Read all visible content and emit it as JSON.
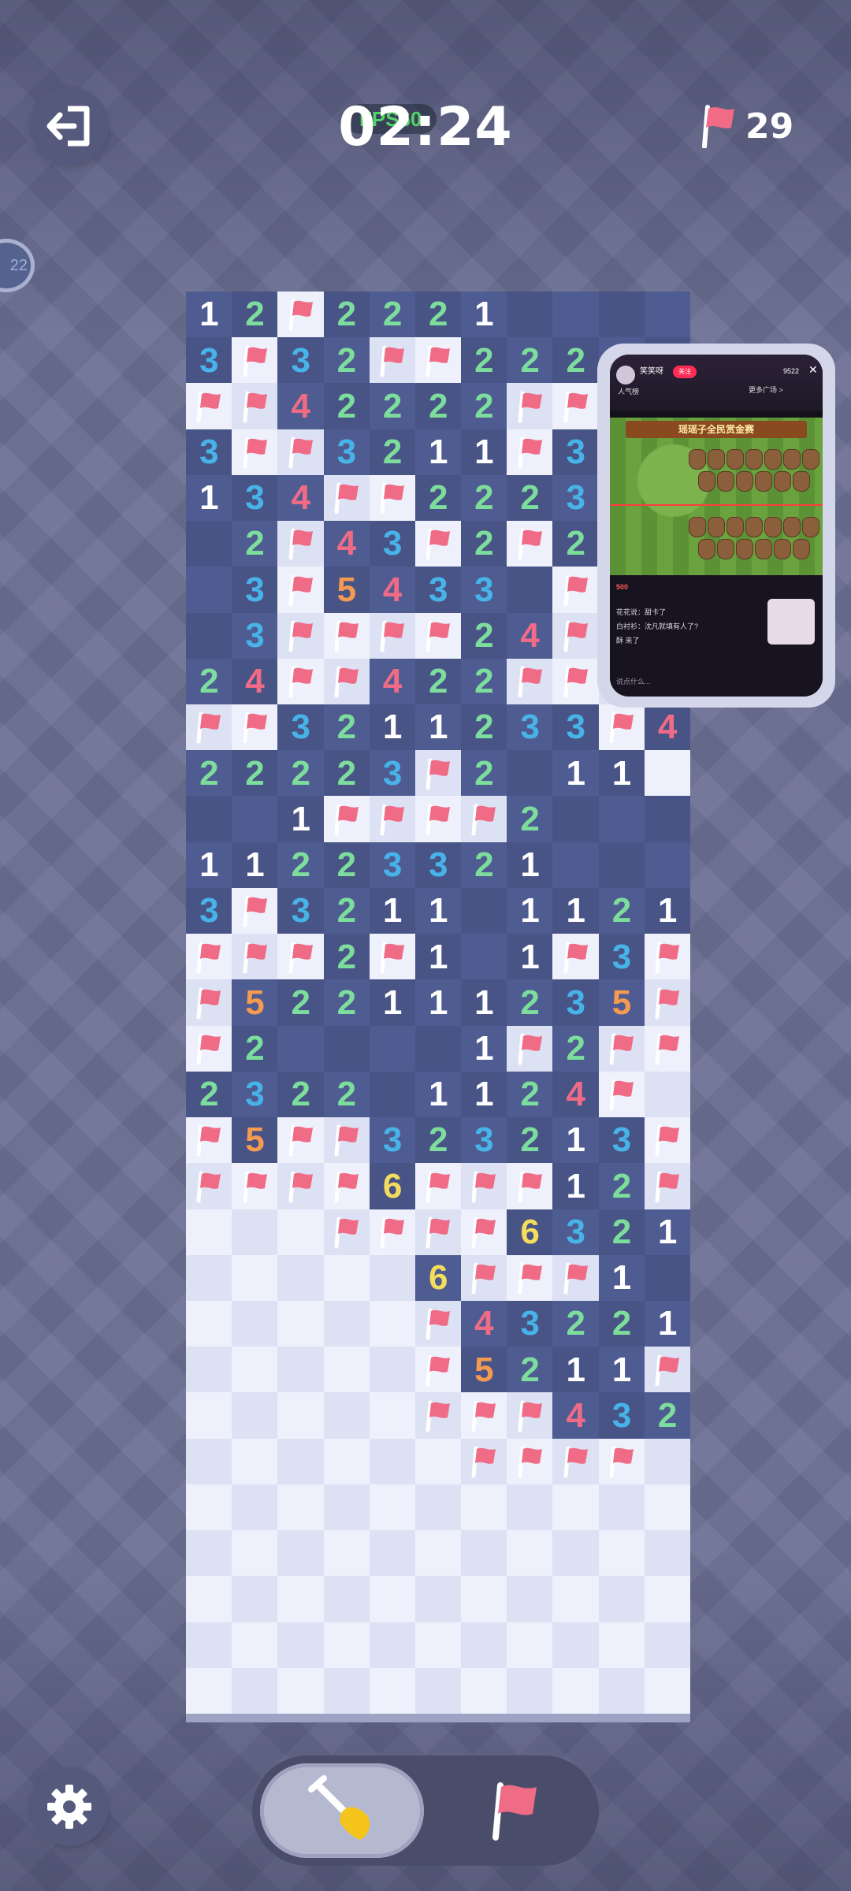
{
  "header": {
    "timer": "02:24",
    "score_badge": "FPS60",
    "flag_count": "29",
    "exit_icon": "exit-icon",
    "flag_icon": "flag-icon",
    "side_badge": "22"
  },
  "board": {
    "cols": 11,
    "rows": 31,
    "legend": "digits=revealed count, F=flag, .=revealed empty, #=unrevealed",
    "grid": [
      "12F2221....",
      "3F32FF222..",
      "FF42222FF..",
      "3FF3211F3F.",
      "134FF2223..",
      ".2F43F2F2..",
      ".3F5433.F..",
      ".3FFFF24F..",
      "24FF422FFF.",
      "FF3211233F4F",
      "22223F2.11",
      "..1FFFF2...",
      "11223321...",
      "3F3211.1121",
      "FFF2F1.1F3F",
      "F52211123 5F",
      "F2....1F2FF",
      "2322.1124F",
      "F5FF3232 13F",
      "FFFF6FFF12F",
      "###FFFF6321",
      "#####6FFF1.",
      "#####F4322 1",
      "#####F5211F",
      "#####FFF432",
      "######FFFF",
      "###########",
      "###########",
      "###########",
      "###########",
      "###########"
    ]
  },
  "tools": {
    "dig_icon": "shovel-icon",
    "flag_icon": "flag-icon",
    "settings_icon": "gear-icon",
    "selected": "dig"
  },
  "pip": {
    "streamer_name": "笑笑呀",
    "follow_label": "关注",
    "viewers": "9522",
    "close": "✕",
    "rank_label": "人气榜",
    "banner_label": "更多广场 >",
    "game_title": "瑶瑶子全民赏金赛",
    "chat": [
      "花花说：甜卡了",
      "白衬衫：沈凡就填有人了?",
      "酥 来了"
    ],
    "input_placeholder": "说点什么...",
    "number_badge": "500"
  },
  "colors": {
    "background": "#6b6f93",
    "revealed_cell": "#4f5c91",
    "hidden_cell": "#eef0fb",
    "flag": "#ef6b86",
    "n1": "#ffffff",
    "n2": "#7ddd9c",
    "n3": "#47b3e8",
    "n4": "#ef6b86",
    "n5": "#f49a51",
    "n6": "#f4dc5c"
  }
}
